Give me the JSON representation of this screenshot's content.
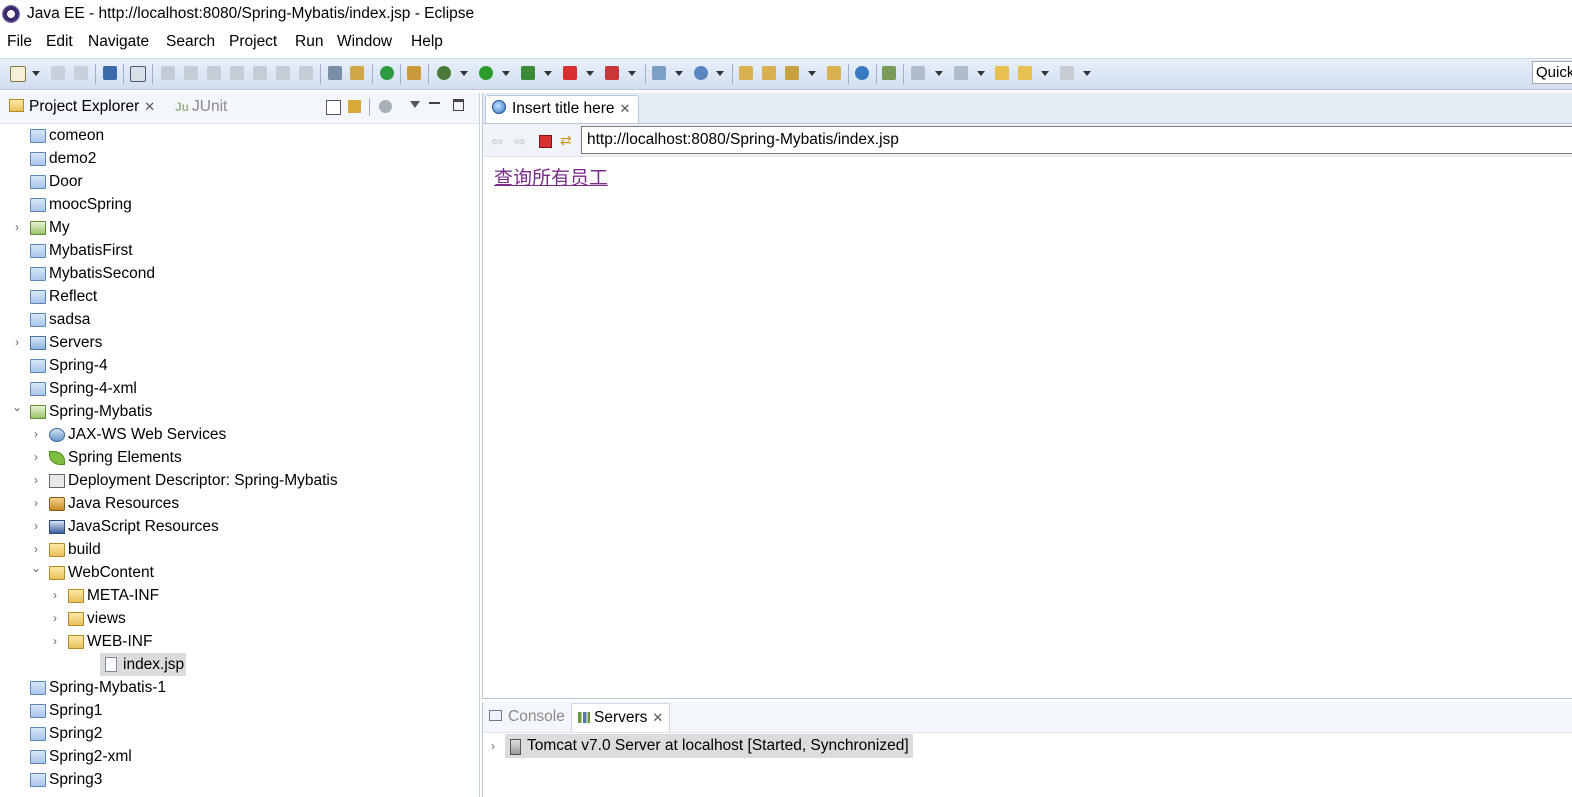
{
  "window": {
    "title": "Java EE - http://localhost:8080/Spring-Mybatis/index.jsp - Eclipse"
  },
  "menu": [
    "File",
    "Edit",
    "Navigate",
    "Search",
    "Project",
    "Run",
    "Window",
    "Help"
  ],
  "toolbar": {
    "quick_access": "Quick"
  },
  "left_panel": {
    "tabs": [
      {
        "label": "Project Explorer",
        "active": true
      },
      {
        "label": "JUnit",
        "icon_text": "Ju",
        "active": false
      }
    ],
    "tree": [
      {
        "label": "comeon",
        "depth": 0,
        "icon": "project-icon",
        "expander": ""
      },
      {
        "label": "demo2",
        "depth": 0,
        "icon": "project-icon",
        "expander": ""
      },
      {
        "label": "Door",
        "depth": 0,
        "icon": "project-icon",
        "expander": ""
      },
      {
        "label": "moocSpring",
        "depth": 0,
        "icon": "project-icon",
        "expander": ""
      },
      {
        "label": "My",
        "depth": 0,
        "icon": "web-project-icon",
        "expander": "collapsed"
      },
      {
        "label": "MybatisFirst",
        "depth": 0,
        "icon": "project-icon",
        "expander": ""
      },
      {
        "label": "MybatisSecond",
        "depth": 0,
        "icon": "project-icon",
        "expander": ""
      },
      {
        "label": "Reflect",
        "depth": 0,
        "icon": "project-icon",
        "expander": ""
      },
      {
        "label": "sadsa",
        "depth": 0,
        "icon": "project-icon",
        "expander": ""
      },
      {
        "label": "Servers",
        "depth": 0,
        "icon": "server-folder-icon",
        "expander": "collapsed"
      },
      {
        "label": "Spring-4",
        "depth": 0,
        "icon": "project-icon",
        "expander": ""
      },
      {
        "label": "Spring-4-xml",
        "depth": 0,
        "icon": "project-icon",
        "expander": ""
      },
      {
        "label": "Spring-Mybatis",
        "depth": 0,
        "icon": "web-project-icon",
        "expander": "expanded"
      },
      {
        "label": "JAX-WS Web Services",
        "depth": 1,
        "icon": "web-services-icon",
        "expander": "collapsed"
      },
      {
        "label": "Spring Elements",
        "depth": 1,
        "icon": "spring-leaf-icon",
        "expander": "collapsed"
      },
      {
        "label": "Deployment Descriptor: Spring-Mybatis",
        "depth": 1,
        "icon": "deployment-descriptor-icon",
        "expander": "collapsed"
      },
      {
        "label": "Java Resources",
        "depth": 1,
        "icon": "java-resources-icon",
        "expander": "collapsed"
      },
      {
        "label": "JavaScript Resources",
        "depth": 1,
        "icon": "javascript-resources-icon",
        "expander": "collapsed"
      },
      {
        "label": "build",
        "depth": 1,
        "icon": "folder-icon",
        "expander": "collapsed"
      },
      {
        "label": "WebContent",
        "depth": 1,
        "icon": "folder-icon",
        "expander": "expanded"
      },
      {
        "label": "META-INF",
        "depth": 2,
        "icon": "folder-icon",
        "expander": "collapsed"
      },
      {
        "label": "views",
        "depth": 2,
        "icon": "folder-icon",
        "expander": "collapsed"
      },
      {
        "label": "WEB-INF",
        "depth": 2,
        "icon": "folder-icon",
        "expander": "collapsed"
      },
      {
        "label": "index.jsp",
        "depth": 2,
        "icon": "file-icon",
        "expander": "",
        "selected": true
      },
      {
        "label": "Spring-Mybatis-1",
        "depth": 0,
        "icon": "project-icon",
        "expander": ""
      },
      {
        "label": "Spring1",
        "depth": 0,
        "icon": "project-icon",
        "expander": ""
      },
      {
        "label": "Spring2",
        "depth": 0,
        "icon": "project-icon",
        "expander": ""
      },
      {
        "label": "Spring2-xml",
        "depth": 0,
        "icon": "project-icon",
        "expander": ""
      },
      {
        "label": "Spring3",
        "depth": 0,
        "icon": "project-icon",
        "expander": ""
      }
    ]
  },
  "editor": {
    "tab_label": "Insert title here",
    "url": "http://localhost:8080/Spring-Mybatis/index.jsp",
    "page_link": "查询所有员工"
  },
  "bottom_panel": {
    "tabs": [
      {
        "label": "Console",
        "active": false
      },
      {
        "label": "Servers",
        "active": true
      }
    ],
    "server_row": "Tomcat v7.0 Server at localhost  [Started, Synchronized]"
  }
}
